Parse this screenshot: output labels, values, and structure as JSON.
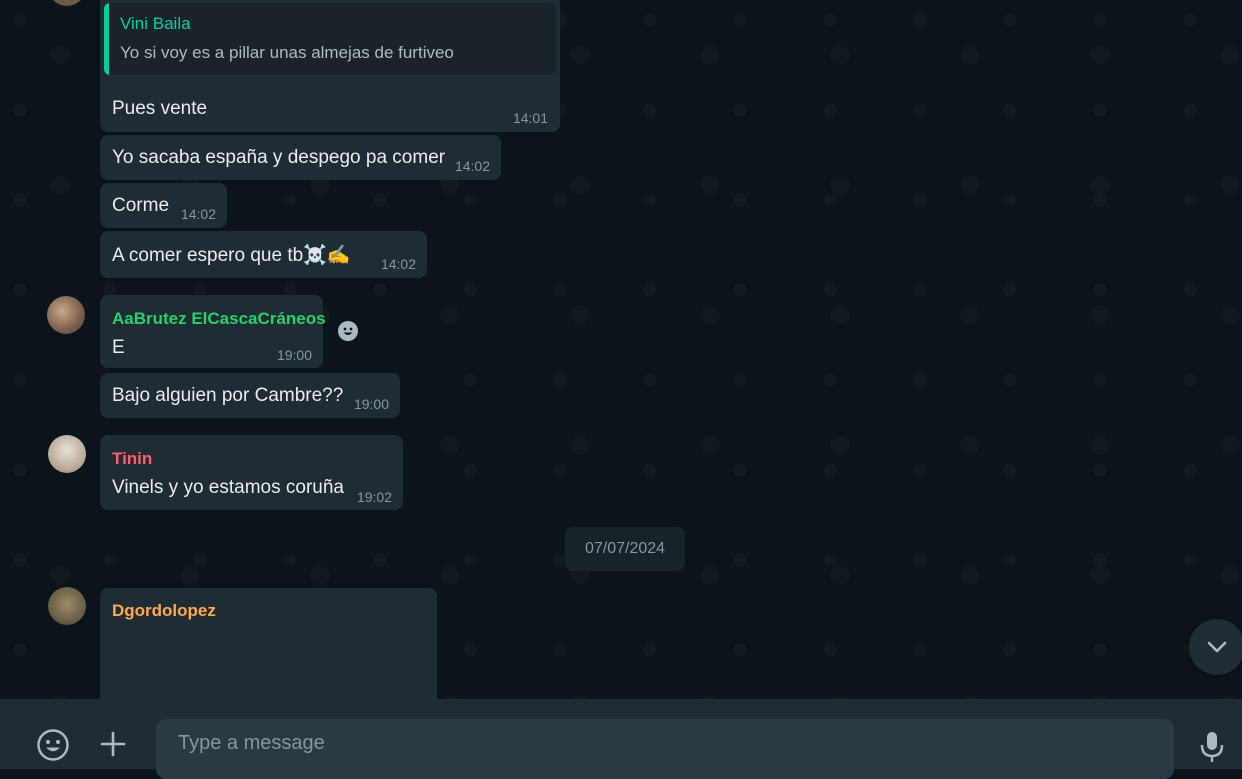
{
  "messages": [
    {
      "quote": {
        "name": "Vini Baila",
        "text": "Yo si voy es a pillar unas almejas de furtiveo"
      },
      "text": "Pues vente",
      "time": "14:01"
    },
    {
      "text": "Yo sacaba españa y despego pa comer",
      "time": "14:02"
    },
    {
      "text": "Corme",
      "time": "14:02"
    },
    {
      "text": "A comer espero que tb☠️✍️",
      "time": "14:02"
    },
    {
      "sender": "AaBrutez ElCascaCráneos",
      "text": "E",
      "time": "19:00"
    },
    {
      "text": "Bajo alguien por Cambre??",
      "time": "19:00"
    },
    {
      "sender": "Tinin",
      "text": "Vinels y yo estamos coruña",
      "time": "19:02"
    },
    {
      "sender": "Dgordolopez",
      "text": "",
      "time": ""
    }
  ],
  "date_separator": "07/07/2024",
  "composer": {
    "placeholder": "Type a message"
  },
  "colors": {
    "background": "#0b141a",
    "bubble": "#202c33",
    "sender_aabrutez": "#25d366",
    "sender_tinin": "#ff5f6d",
    "sender_dgordolopez": "#ffa94d",
    "quote_accent": "#06cf9c",
    "time": "#8696a0"
  },
  "icons": {
    "emoji": "smiley-icon",
    "attach": "plus-icon",
    "mic": "microphone-icon",
    "scroll": "chevron-down-icon",
    "reaction": "reaction-smiley-icon"
  }
}
